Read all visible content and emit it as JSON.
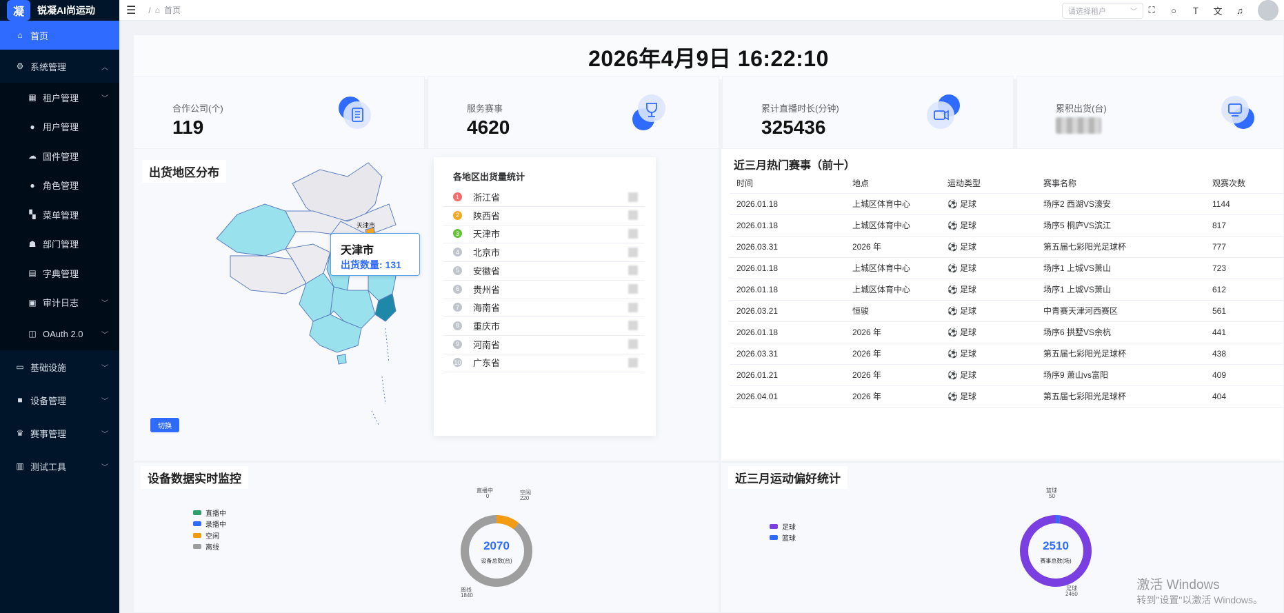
{
  "app": {
    "title": "锐凝AI尚运动",
    "logo_glyph": "凝"
  },
  "sidebar": {
    "home": "首页",
    "system": "系统管理",
    "system_items": [
      "租户管理",
      "用户管理",
      "固件管理",
      "角色管理",
      "菜单管理",
      "部门管理",
      "字典管理",
      "审计日志",
      "OAuth 2.0"
    ],
    "infra": "基础设施",
    "device": "设备管理",
    "match": "赛事管理",
    "test": "测试工具"
  },
  "topbar": {
    "breadcrumb_sep": "/",
    "breadcrumb": "首页",
    "tenant_placeholder": "请选择租户"
  },
  "clock": "2026年4月9日 16:22:10",
  "stats": [
    {
      "label": "合作公司(个)",
      "value": "119",
      "icon": "document-icon"
    },
    {
      "label": "服务赛事",
      "value": "4620",
      "icon": "trophy-icon"
    },
    {
      "label": "累计直播时长(分钟)",
      "value": "325436",
      "icon": "camera-icon"
    },
    {
      "label": "累积出货(台)",
      "value": "",
      "icon": "monitor-icon"
    }
  ],
  "map": {
    "title": "出货地区分布",
    "switch": "切换",
    "marker": "天津市",
    "tooltip_city": "天津市",
    "tooltip_value": "出货数量: 131"
  },
  "ranking": {
    "title": "各地区出货量统计",
    "rows": [
      "浙江省",
      "陕西省",
      "天津市",
      "北京市",
      "安徽省",
      "贵州省",
      "海南省",
      "重庆市",
      "河南省",
      "广东省"
    ],
    "colors": [
      "#f56c6c",
      "#f5a623",
      "#67c23a",
      "#c0c4cc",
      "#c0c4cc",
      "#c0c4cc",
      "#c0c4cc",
      "#c0c4cc",
      "#c0c4cc",
      "#c0c4cc"
    ]
  },
  "hot": {
    "title": "近三月热门赛事（前十）",
    "headers": [
      "时间",
      "地点",
      "运动类型",
      "赛事名称",
      "观赛次数"
    ],
    "rows": [
      [
        "2026.01.18",
        "上城区体育中心",
        "足球",
        "场序2 西湖VS濠安",
        "1144"
      ],
      [
        "2026.01.18",
        "上城区体育中心",
        "足球",
        "场序5 桐庐VS滨江",
        "817"
      ],
      [
        "2026.03.31",
        "2026 年",
        "足球",
        "第五届七彩阳光足球杯",
        "777"
      ],
      [
        "2026.01.18",
        "上城区体育中心",
        "足球",
        "场序1 上城VS萧山",
        "723"
      ],
      [
        "2026.01.18",
        "上城区体育中心",
        "足球",
        "场序1 上城VS萧山",
        "612"
      ],
      [
        "2026.03.21",
        "恒骏",
        "足球",
        "中青赛天津河西赛区",
        "561"
      ],
      [
        "2026.01.18",
        "2026 年",
        "足球",
        "场序6 拱墅VS余杭",
        "441"
      ],
      [
        "2026.03.31",
        "2026 年",
        "足球",
        "第五届七彩阳光足球杯",
        "438"
      ],
      [
        "2026.01.21",
        "2026 年",
        "足球",
        "场序9 萧山vs富阳",
        "409"
      ],
      [
        "2026.04.01",
        "2026 年",
        "足球",
        "第五届七彩阳光足球杯",
        "404"
      ]
    ]
  },
  "device": {
    "title": "设备数据实时监控",
    "legend": [
      {
        "name": "直播中",
        "color": "#2e9e6a"
      },
      {
        "name": "录播中",
        "color": "#2f6bff"
      },
      {
        "name": "空闲",
        "color": "#f39c12"
      },
      {
        "name": "离线",
        "color": "#9e9e9e"
      }
    ],
    "total": "2070",
    "total_label": "设备总数(台)",
    "slices": [
      {
        "name": "直播中",
        "value": 0
      },
      {
        "name": "空闲",
        "value": 220
      },
      {
        "name": "离线",
        "value": 1840
      }
    ]
  },
  "sport": {
    "title": "近三月运动偏好统计",
    "legend": [
      {
        "name": "足球",
        "color": "#7a3fe0"
      },
      {
        "name": "篮球",
        "color": "#2f6bff"
      }
    ],
    "total": "2510",
    "total_label": "赛事总数(场)",
    "slices": [
      {
        "name": "篮球",
        "value": 50
      },
      {
        "name": "足球",
        "value": 2460
      }
    ]
  },
  "watermark": {
    "line1": "激活 Windows",
    "line2": "转到\"设置\"以激活 Windows。"
  }
}
